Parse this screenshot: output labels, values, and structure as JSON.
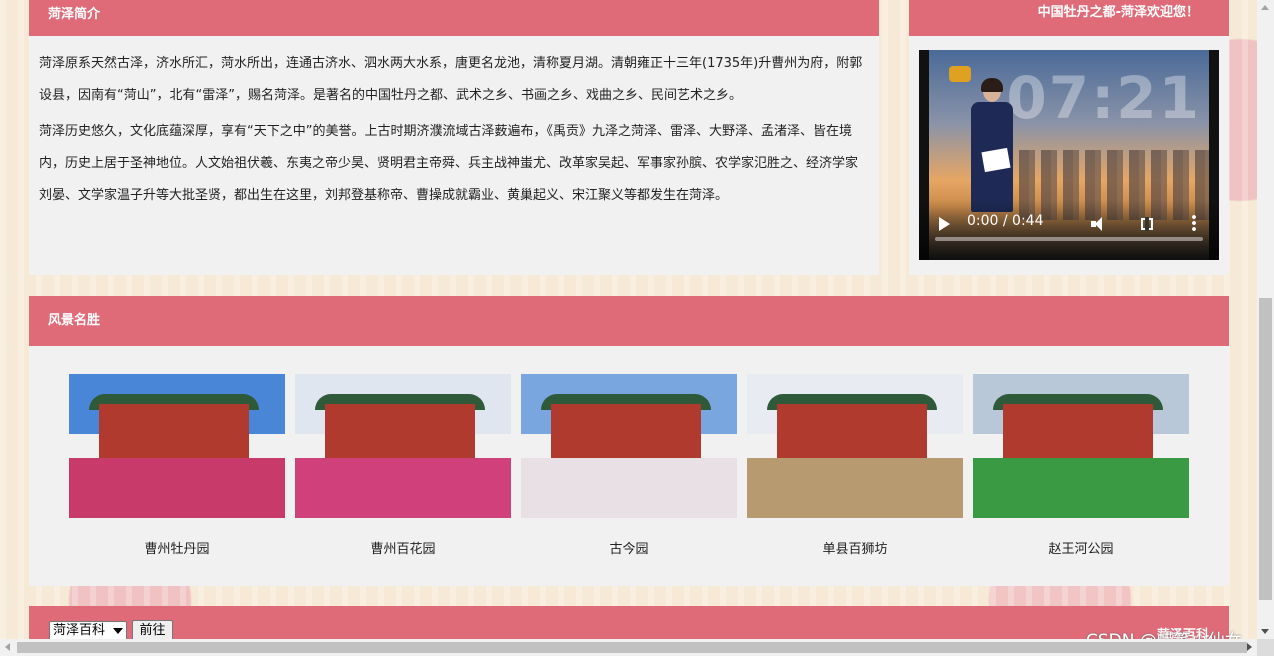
{
  "intro": {
    "title": "菏泽简介",
    "paragraphs": [
      "菏泽原系天然古泽，济水所汇，菏水所出，连通古济水、泗水两大水系，唐更名龙池，清称夏月湖。清朝雍正十三年(1735年)升曹州为府，附郭设县，因南有“菏山”，北有“雷泽”，赐名菏泽。是著名的中国牡丹之都、武术之乡、书画之乡、戏曲之乡、民间艺术之乡。",
      "菏泽历史悠久，文化底蕴深厚，享有“天下之中”的美誉。上古时期济濮流域古泽薮遍布，《禹贡》九泽之菏泽、雷泽、大野泽、孟渚泽、皆在境内，历史上居于圣神地位。人文始祖伏羲、东夷之帝少昊、贤明君主帝舜、兵主战神蚩尤、改革家吴起、军事家孙膑、农学家氾胜之、经济学家刘晏、文学家温子升等大批圣贤，都出生在这里，刘邦登基称帝、曹操成就霸业、黄巢起义、宋江聚义等都发生在菏泽。"
    ]
  },
  "video": {
    "title": "中国牡丹之都-菏泽欢迎您！",
    "overlay_clock": "07:21",
    "time": "0:00 / 0:44",
    "progress": 0
  },
  "scenic": {
    "title": "风景名胜",
    "items": [
      {
        "caption": "曹州牡丹园",
        "sky": "#4a86d8",
        "ground": "#c83a6a"
      },
      {
        "caption": "曹州百花园",
        "sky": "#dfe6f0",
        "ground": "#d0407a"
      },
      {
        "caption": "古今园",
        "sky": "#7aa6e0",
        "ground": "#e8e0e4"
      },
      {
        "caption": "单县百狮坊",
        "sky": "#e8ecf2",
        "ground": "#b89a70"
      },
      {
        "caption": "赵王河公园",
        "sky": "#b8c8d8",
        "ground": "#3a9a44"
      }
    ]
  },
  "bottom": {
    "select_value": "菏泽百科",
    "go_label": "前往",
    "right_text": "菏泽百科"
  },
  "watermark": "CSDN @蜡笔小仙女"
}
